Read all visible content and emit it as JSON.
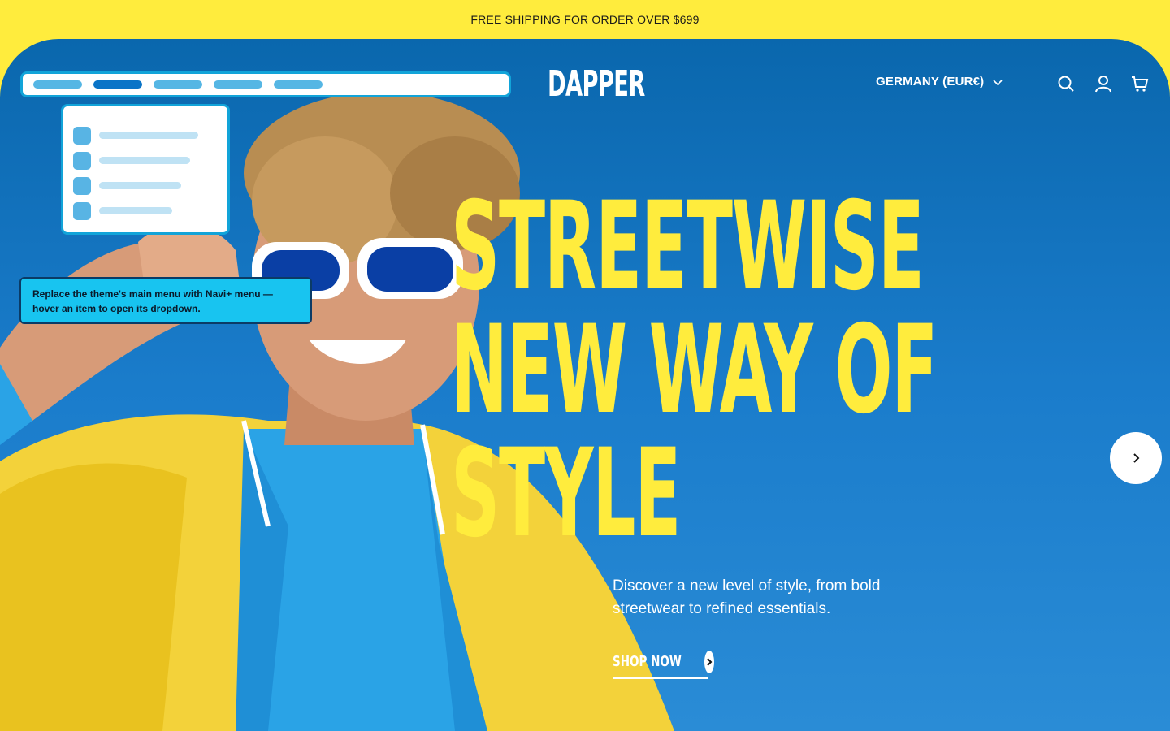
{
  "announcement": {
    "text": "FREE SHIPPING FOR ORDER OVER $699"
  },
  "header": {
    "logo": "DAPPER",
    "country_selector": "GERMANY (EUR€)",
    "icons": [
      "search-icon",
      "account-icon",
      "cart-icon"
    ]
  },
  "nav_mock": {
    "pills": 5,
    "active_index": 1
  },
  "dropdown_mock": {
    "rows": 4
  },
  "tooltip": {
    "line1": "Replace the theme's main menu with Navi+ menu —",
    "line2": "hover an item to open its dropdown."
  },
  "hero": {
    "headline_lines": [
      "STREETWISE",
      "NEW WAY OF",
      "STYLE"
    ],
    "subcopy": "Discover a new level of style, from bold streetwear to refined essentials.",
    "cta_label": "SHOP NOW"
  },
  "colors": {
    "brand_yellow": "#FFEC3D",
    "hero_blue": "#0a67ad",
    "tooltip_cyan": "#18c4f0",
    "nav_accent": "#0a74c7"
  }
}
